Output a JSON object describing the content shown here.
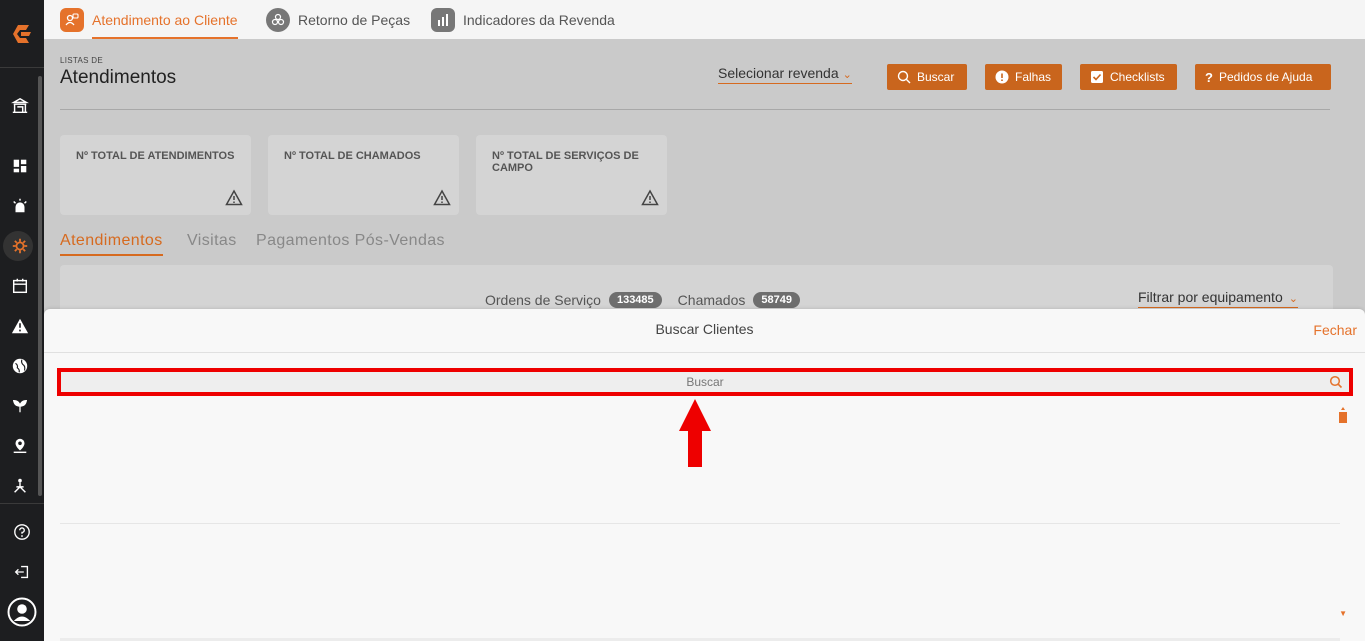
{
  "top_tabs": [
    {
      "label": "Atendimento ao Cliente",
      "active": true
    },
    {
      "label": "Retorno de Peças",
      "active": false
    },
    {
      "label": "Indicadores da Revenda",
      "active": false
    }
  ],
  "page": {
    "subtitle": "LISTAS DE",
    "title": "Atendimentos",
    "select_dealer": "Selecionar revenda"
  },
  "header_buttons": {
    "search": "Buscar",
    "failures": "Falhas",
    "checklists": "Checklists",
    "help_requests": "Pedidos de Ajuda"
  },
  "stat_cards": [
    {
      "label": "Nº TOTAL DE ATENDIMENTOS"
    },
    {
      "label": "Nº TOTAL DE CHAMADOS"
    },
    {
      "label": "Nº TOTAL DE SERVIÇOS DE CAMPO"
    }
  ],
  "sub_tabs": [
    {
      "label": "Atendimentos",
      "active": true
    },
    {
      "label": "Visitas",
      "active": false
    },
    {
      "label": "Pagamentos Pós-Vendas",
      "active": false
    }
  ],
  "counts": {
    "service_orders_label": "Ordens de Serviço",
    "service_orders_count": "133485",
    "calls_label": "Chamados",
    "calls_count": "58749"
  },
  "filter_equipment": "Filtrar por equipamento",
  "modal": {
    "title": "Buscar Clientes",
    "close": "Fechar",
    "search_placeholder": "Buscar"
  },
  "colors": {
    "accent": "#e5722b",
    "sidebar": "#1d1e20",
    "highlight": "#ee0000"
  }
}
